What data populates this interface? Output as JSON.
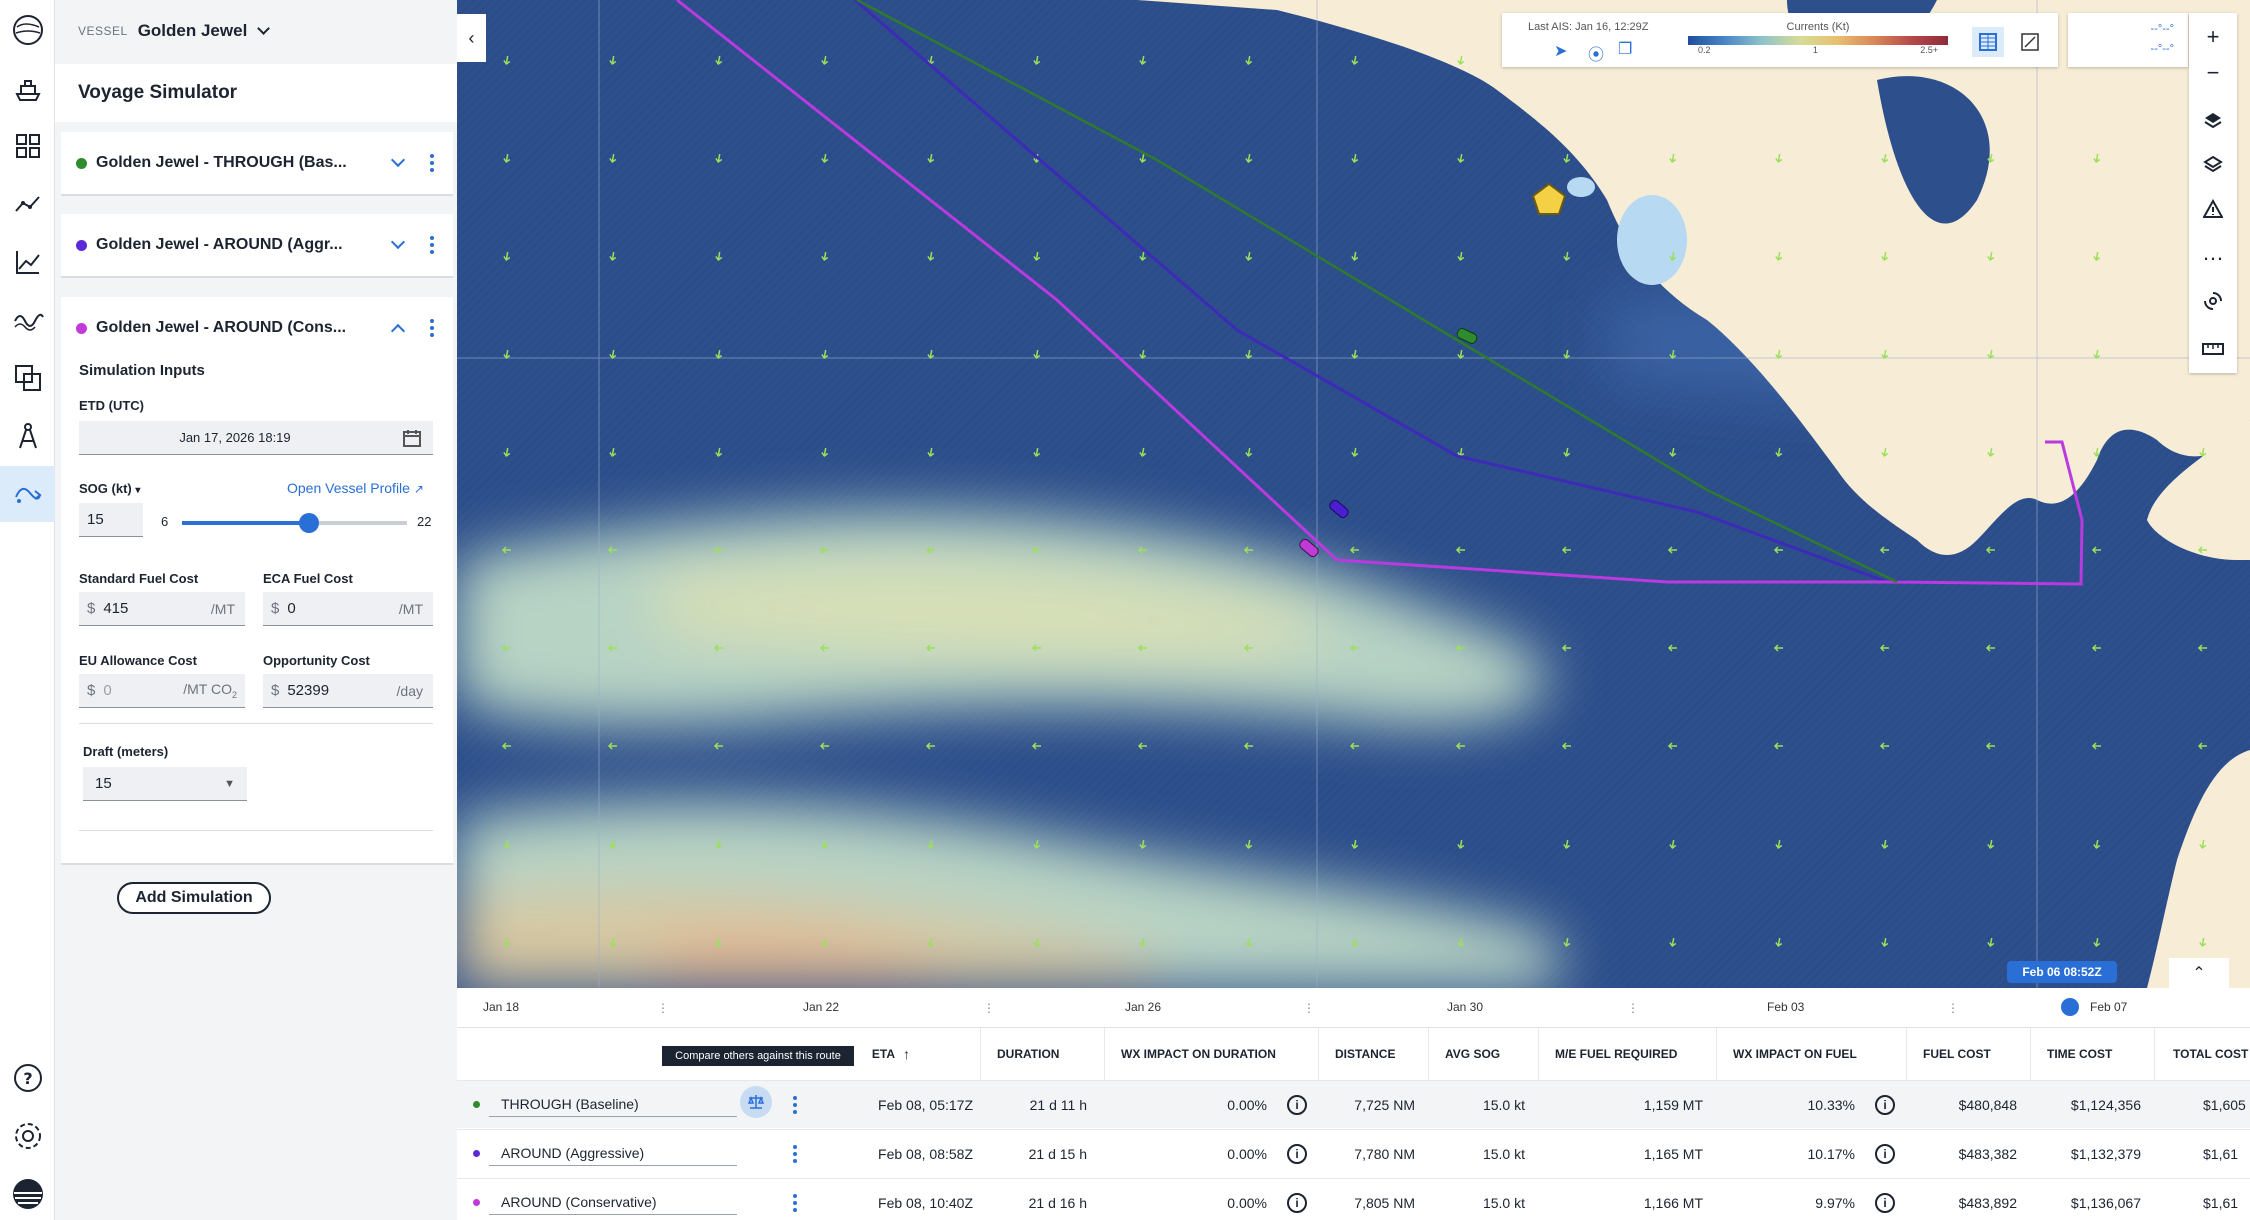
{
  "vessel": {
    "tag": "VESSEL",
    "name": "Golden Jewel"
  },
  "panel": {
    "title": "Voyage Simulator"
  },
  "simulations": [
    {
      "name": "Golden Jewel - THROUGH (Bas...",
      "color": "#2e8b2e",
      "expanded": false
    },
    {
      "name": "Golden Jewel - AROUND (Aggr...",
      "color": "#5b2bd8",
      "expanded": false
    },
    {
      "name": "Golden Jewel - AROUND (Cons...",
      "color": "#c03ad8",
      "expanded": true
    }
  ],
  "inputs": {
    "section": "Simulation Inputs",
    "etd_label": "ETD (UTC)",
    "etd_value": "Jan 17, 2026 18:19",
    "sog_label": "SOG (kt)",
    "open_profile": "Open Vessel Profile",
    "sog_value": "15",
    "sog_min": "6",
    "sog_max": "22",
    "sog_fraction": 0.5625,
    "std_fuel_label": "Standard Fuel Cost",
    "std_fuel_value": "415",
    "eca_fuel_label": "ECA Fuel Cost",
    "eca_fuel_value": "0",
    "eu_label": "EU Allowance Cost",
    "eu_value": "0",
    "opp_label": "Opportunity Cost",
    "opp_value": "52399",
    "draft_label": "Draft (meters)",
    "draft_value": "15",
    "currency": "$",
    "per_mt": "/MT",
    "per_mt_co2": "/MT CO",
    "co2_sub": "2",
    "per_day": "/day"
  },
  "add_simulation": "Add Simulation",
  "map": {
    "last_ais": "Last AIS: Jan 16, 12:29Z",
    "currents_title": "Currents (Kt)",
    "scale_ticks": [
      "0.2",
      "1",
      "2.5+"
    ],
    "contour_1": "--°--°",
    "contour_2": "--°--°"
  },
  "timeline": {
    "labels": [
      "Jan 18",
      "Jan 22",
      "Jan 26",
      "Jan 30",
      "Feb 03",
      "Feb 07"
    ],
    "current": "Feb 06 08:52Z"
  },
  "tooltip": "Compare others against this route",
  "table": {
    "headers": [
      "ETA",
      "DURATION",
      "WX IMPACT ON DURATION",
      "DISTANCE",
      "AVG SOG",
      "M/E FUEL REQUIRED",
      "WX IMPACT ON FUEL",
      "FUEL COST",
      "TIME COST",
      "TOTAL COST"
    ],
    "rows": [
      {
        "name": "THROUGH (Baseline)",
        "color": "#2e8b2e",
        "eta": "Feb 08, 05:17Z",
        "duration": "21 d 11 h",
        "wx_dur": "0.00%",
        "distance": "7,725 NM",
        "sog": "15.0 kt",
        "fuel": "1,159 MT",
        "wx_fuel": "10.33%",
        "fuel_cost": "$480,848",
        "time_cost": "$1,124,356",
        "total": "$1,605"
      },
      {
        "name": "AROUND (Aggressive)",
        "color": "#5b2bd8",
        "eta": "Feb 08, 08:58Z",
        "duration": "21 d 15 h",
        "wx_dur": "0.00%",
        "distance": "7,780 NM",
        "sog": "15.0 kt",
        "fuel": "1,165 MT",
        "wx_fuel": "10.17%",
        "fuel_cost": "$483,382",
        "time_cost": "$1,132,379",
        "total": "$1,61"
      },
      {
        "name": "AROUND (Conservative)",
        "color": "#c03ad8",
        "eta": "Feb 08, 10:40Z",
        "duration": "21 d 16 h",
        "wx_dur": "0.00%",
        "distance": "7,805 NM",
        "sog": "15.0 kt",
        "fuel": "1,166 MT",
        "wx_fuel": "9.97%",
        "fuel_cost": "$483,892",
        "time_cost": "$1,136,067",
        "total": "$1,61"
      }
    ]
  }
}
